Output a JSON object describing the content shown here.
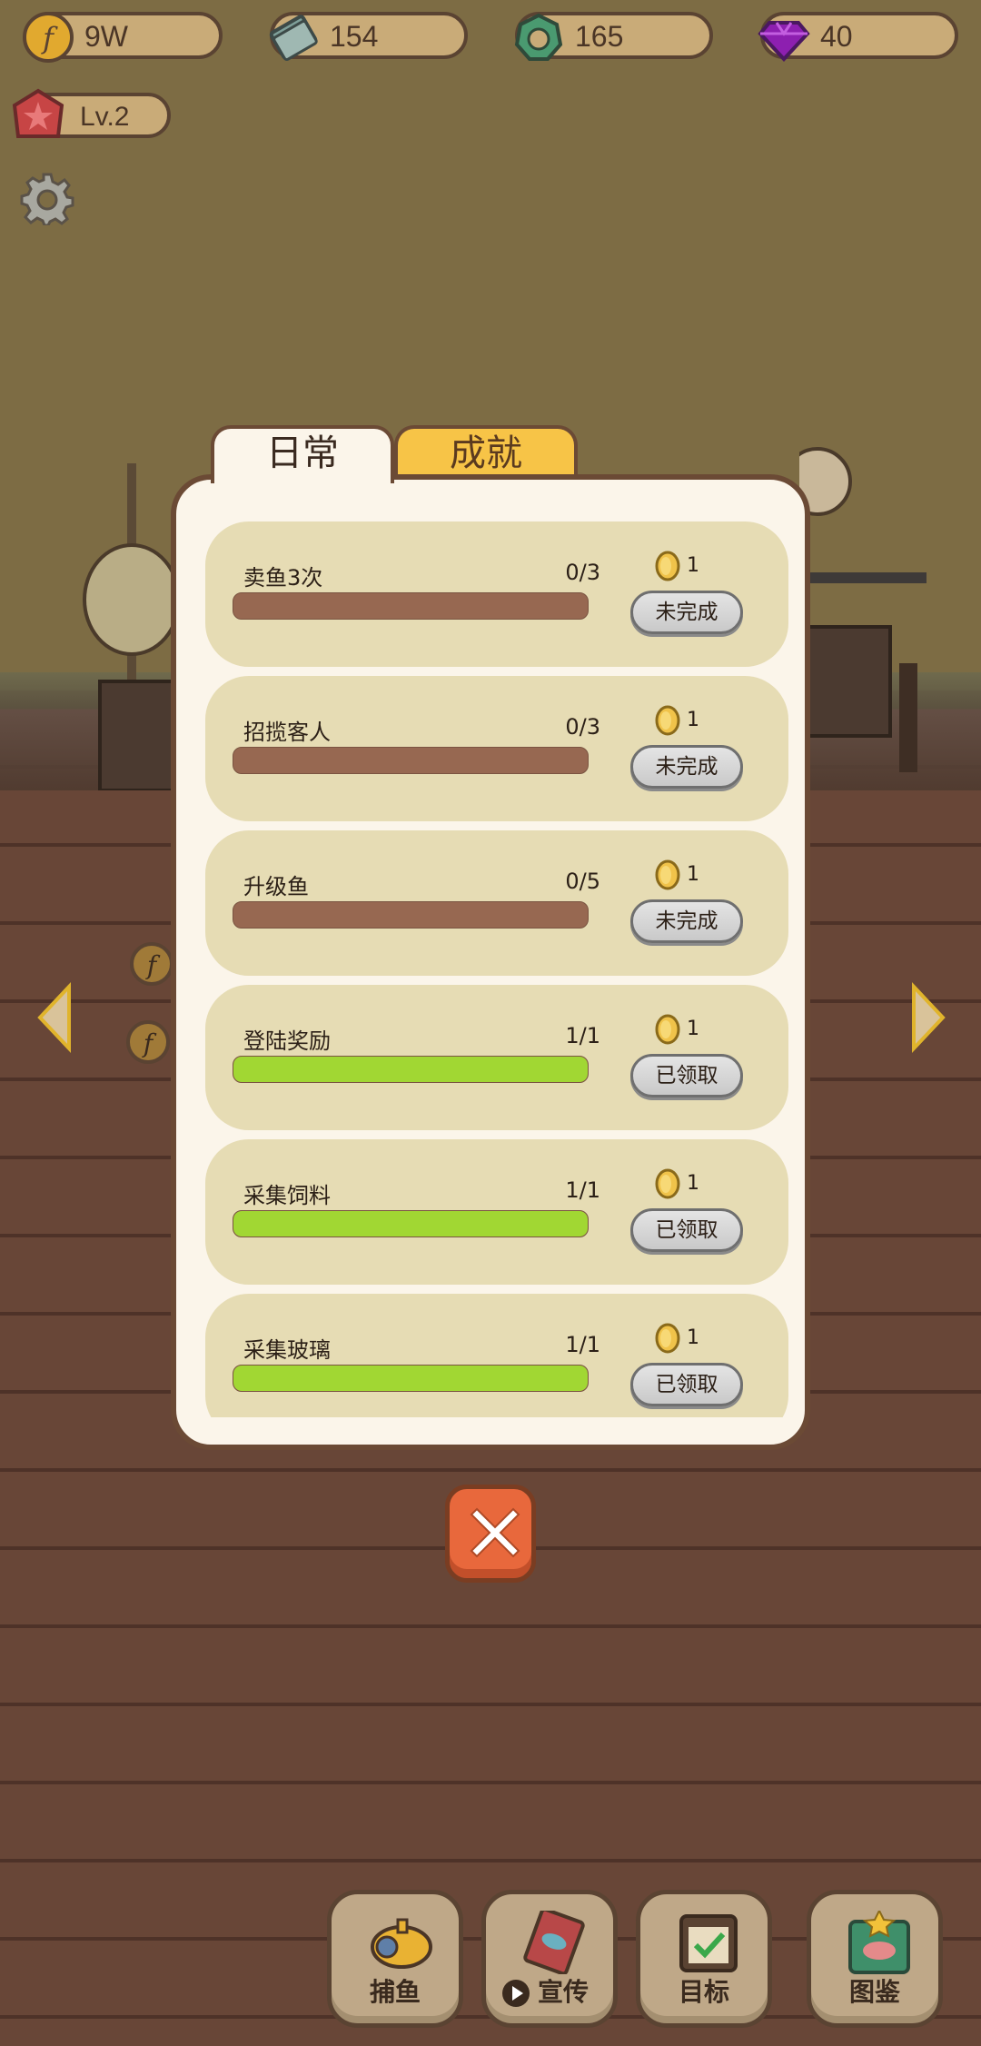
{
  "hud": {
    "coins": "9W",
    "cash": "154",
    "shells": "165",
    "gems": "40",
    "level": "Lv.2"
  },
  "tabs": {
    "daily": "日常",
    "achievements": "成就"
  },
  "quests": [
    {
      "title": "卖鱼3次",
      "count": "0/3",
      "progress": 0,
      "reward": "1",
      "button": "未完成"
    },
    {
      "title": "招揽客人",
      "count": "0/3",
      "progress": 0,
      "reward": "1",
      "button": "未完成"
    },
    {
      "title": "升级鱼",
      "count": "0/5",
      "progress": 0,
      "reward": "1",
      "button": "未完成"
    },
    {
      "title": "登陆奖励",
      "count": "1/1",
      "progress": 1,
      "reward": "1",
      "button": "已领取"
    },
    {
      "title": "采集饲料",
      "count": "1/1",
      "progress": 1,
      "reward": "1",
      "button": "已领取"
    },
    {
      "title": "采集玻璃",
      "count": "1/1",
      "progress": 1,
      "reward": "1",
      "button": "已领取"
    }
  ],
  "nav": {
    "fishing": "捕鱼",
    "promote": "宣传",
    "goals": "目标",
    "collection": "图鉴"
  },
  "colors": {
    "panel_bg": "#fbf5ea",
    "row_bg": "#e6dcb4",
    "bar_empty": "#976851",
    "bar_full": "#a1d733",
    "tab_active": "#f7c447",
    "close_button": "#e8683c"
  }
}
